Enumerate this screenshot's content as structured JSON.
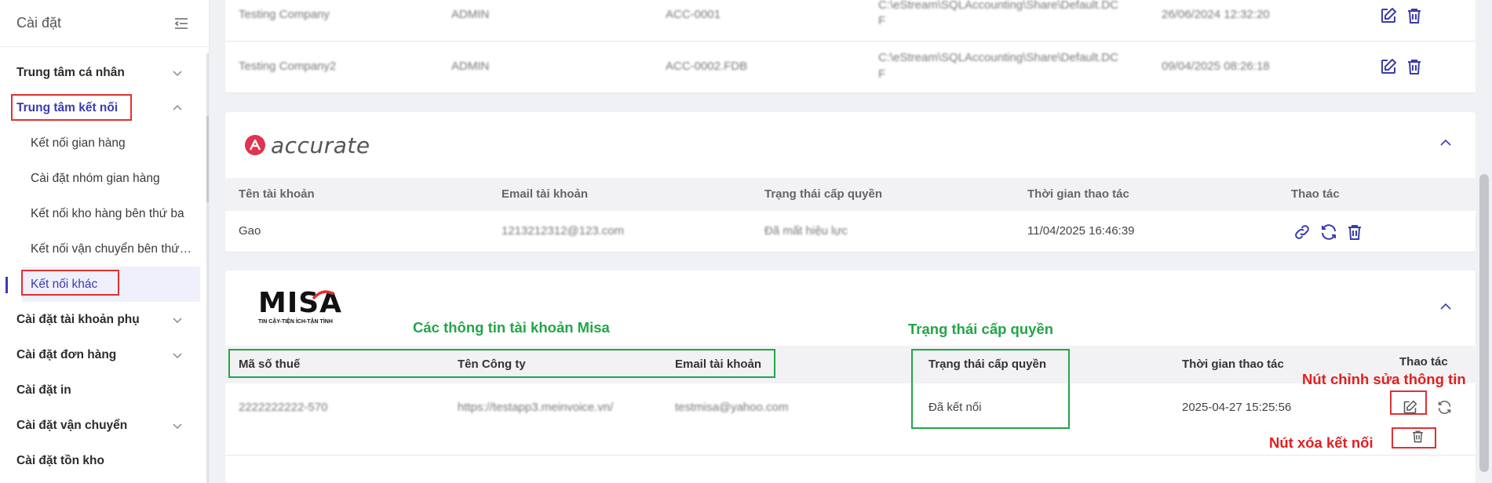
{
  "sidebar": {
    "title": "Cài đặt",
    "items": [
      {
        "label": "Trung tâm cá nhân"
      },
      {
        "label": "Trung tâm kết nối"
      },
      {
        "label": "Cài đặt tài khoản phụ"
      },
      {
        "label": "Cài đặt đơn hàng"
      },
      {
        "label": "Cài đặt in"
      },
      {
        "label": "Cài đặt vận chuyển"
      },
      {
        "label": "Cài đặt tồn kho"
      }
    ],
    "subitems": [
      {
        "label": "Kết nối gian hàng"
      },
      {
        "label": "Cài đặt nhóm gian hàng"
      },
      {
        "label": "Kết nối kho hàng bên thứ ba"
      },
      {
        "label": "Kết nối vận chuyển bên thứ…"
      },
      {
        "label": "Kết nối khác"
      }
    ]
  },
  "sql_rows": [
    {
      "company": "Testing Company",
      "user": "ADMIN",
      "db": "ACC-0001",
      "path_line1": "C:\\eStream\\SQLAccounting\\Share\\Default.DC",
      "path_line2": "F",
      "time": "26/06/2024 12:32:20"
    },
    {
      "company": "Testing Company2",
      "user": "ADMIN",
      "db": "ACC-0002.FDB",
      "path_line1": "C:\\eStream\\SQLAccounting\\Share\\Default.DC",
      "path_line2": "F",
      "time": "09/04/2025 08:26:18"
    }
  ],
  "accurate": {
    "logo_text": "accurate",
    "headers": [
      "Tên tài khoản",
      "Email tài khoản",
      "Trạng thái cấp quyền",
      "Thời gian thao tác",
      "Thao tác"
    ],
    "row": {
      "name": "Gao",
      "email": "1213212312@123.com",
      "status": "Đã mất hiệu lực",
      "time": "11/04/2025 16:46:39"
    }
  },
  "misa": {
    "logo_text": "MISA",
    "logo_tagline": "TIN CẬY-TIỆN ÍCH-TẬN TÌNH",
    "headers": [
      "Mã số thuế",
      "Tên Công ty",
      "Email tài khoản",
      "Trạng thái cấp quyền",
      "Thời gian thao tác",
      "Thao tác"
    ],
    "row": {
      "tax": "2222222222-570",
      "company": "https://testapp3.meinvoice.vn/",
      "email": "testmisa@yahoo.com",
      "status": "Đã kết nối",
      "time": "2025-04-27 15:25:56"
    }
  },
  "annotations": {
    "account_info": "Các thông tin tài khoản Misa",
    "permission_status": "Trạng thái cấp quyền",
    "edit_button": "Nút chỉnh sửa thông tin",
    "delete_button": "Nút xóa kết nối"
  },
  "colors": {
    "accent": "#3b3bb0",
    "annotation_red": "#e23030",
    "annotation_green": "#22a548",
    "accurate_brand": "#e0344f"
  }
}
